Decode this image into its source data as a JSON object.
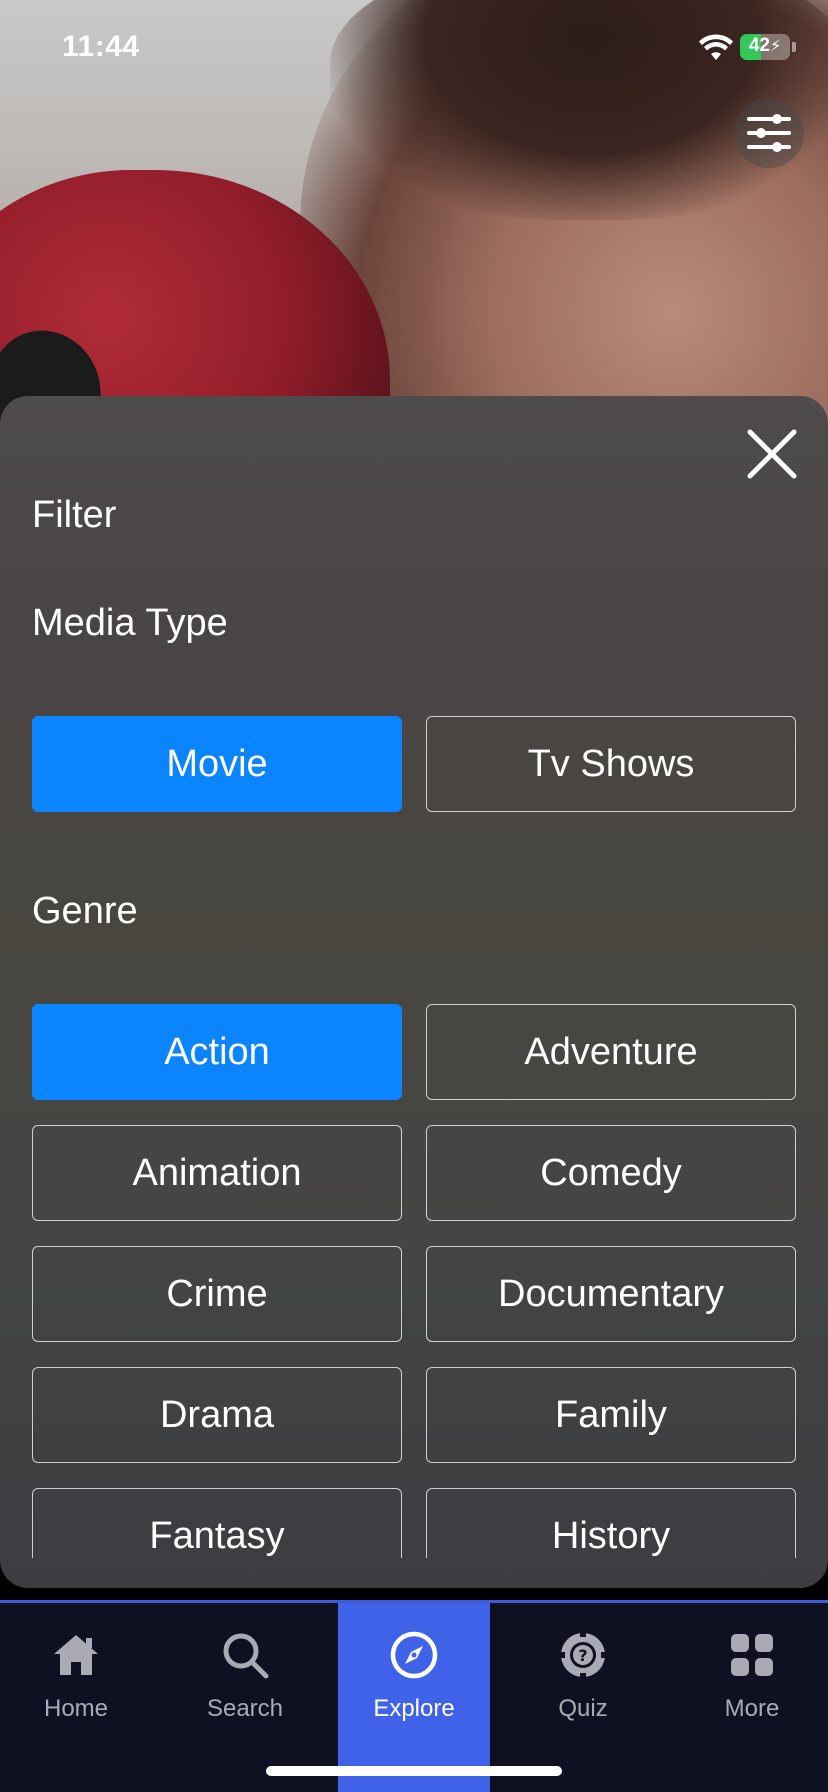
{
  "status_bar": {
    "time": "11:44",
    "battery_percent": 42,
    "battery_label": "42",
    "charging": true
  },
  "sheet": {
    "title": "Filter",
    "media_type": {
      "heading": "Media Type",
      "options": [
        {
          "label": "Movie",
          "selected": true
        },
        {
          "label": "Tv Shows",
          "selected": false
        }
      ]
    },
    "genre": {
      "heading": "Genre",
      "options": [
        {
          "label": "Action",
          "selected": true
        },
        {
          "label": "Adventure",
          "selected": false
        },
        {
          "label": "Animation",
          "selected": false
        },
        {
          "label": "Comedy",
          "selected": false
        },
        {
          "label": "Crime",
          "selected": false
        },
        {
          "label": "Documentary",
          "selected": false
        },
        {
          "label": "Drama",
          "selected": false
        },
        {
          "label": "Family",
          "selected": false
        },
        {
          "label": "Fantasy",
          "selected": false
        },
        {
          "label": "History",
          "selected": false
        }
      ]
    }
  },
  "tabbar": {
    "items": [
      {
        "label": "Home",
        "icon": "home-icon",
        "active": false
      },
      {
        "label": "Search",
        "icon": "search-icon",
        "active": false
      },
      {
        "label": "Explore",
        "icon": "compass-icon",
        "active": true
      },
      {
        "label": "Quiz",
        "icon": "quiz-icon",
        "active": false
      },
      {
        "label": "More",
        "icon": "grid-icon",
        "active": false
      }
    ]
  },
  "colors": {
    "accent": "#0a84ff",
    "tab_active": "#4062e8",
    "tabbar_bg": "#0f1022",
    "battery_green": "#34c759"
  }
}
